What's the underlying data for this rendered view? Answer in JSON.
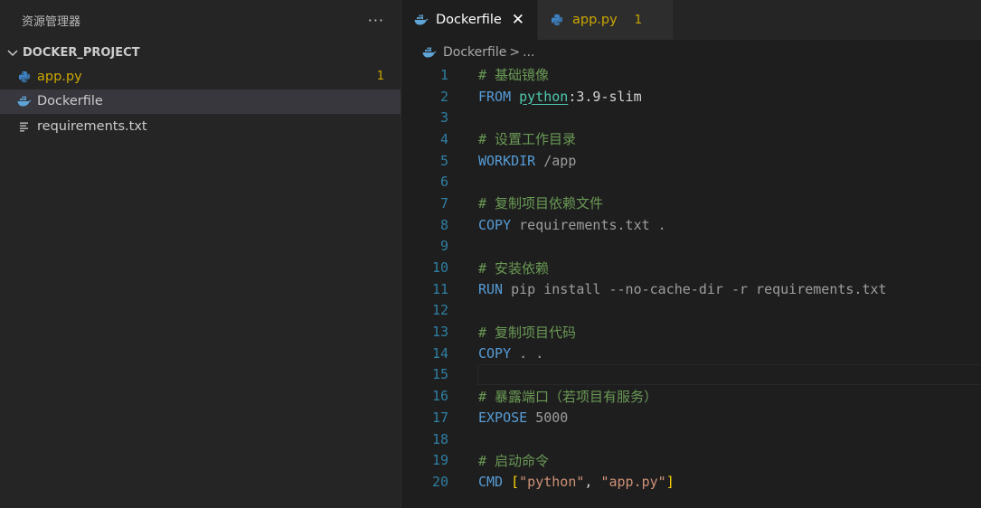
{
  "explorer": {
    "title": "资源管理器",
    "more": "···",
    "section": "DOCKER_PROJECT",
    "files": [
      {
        "name": "app.py",
        "icon": "python-icon",
        "badge": "1"
      },
      {
        "name": "Dockerfile",
        "icon": "docker-icon",
        "badge": ""
      },
      {
        "name": "requirements.txt",
        "icon": "text-file-icon",
        "badge": ""
      }
    ]
  },
  "tabs": [
    {
      "name": "Dockerfile",
      "close": "✕"
    },
    {
      "name": "app.py",
      "badge": "1"
    }
  ],
  "breadcrumb": {
    "file": "Dockerfile",
    "sep": ">",
    "more": "..."
  },
  "code": {
    "lines": [
      {
        "n": "1",
        "comment": "# 基础镜像"
      },
      {
        "n": "2",
        "kw": "FROM",
        "image": "python",
        "rest": ":3.9-slim"
      },
      {
        "n": "3"
      },
      {
        "n": "4",
        "comment": "# 设置工作目录"
      },
      {
        "n": "5",
        "kw": "WORKDIR",
        "arg": "/app"
      },
      {
        "n": "6"
      },
      {
        "n": "7",
        "comment": "# 复制项目依赖文件"
      },
      {
        "n": "8",
        "kw": "COPY",
        "arg": "requirements.txt ."
      },
      {
        "n": "9"
      },
      {
        "n": "10",
        "comment": "# 安装依赖"
      },
      {
        "n": "11",
        "kw": "RUN",
        "arg": "pip install --no-cache-dir -r requirements.txt"
      },
      {
        "n": "12"
      },
      {
        "n": "13",
        "comment": "# 复制项目代码"
      },
      {
        "n": "14",
        "kw": "COPY",
        "arg": ". ."
      },
      {
        "n": "15"
      },
      {
        "n": "16",
        "comment": "# 暴露端口（若项目有服务）"
      },
      {
        "n": "17",
        "kw": "EXPOSE",
        "arg": "5000"
      },
      {
        "n": "18"
      },
      {
        "n": "19",
        "comment": "# 启动命令"
      },
      {
        "n": "20",
        "kw": "CMD",
        "open": "[",
        "s1": "\"python\"",
        "comma": ", ",
        "s2": "\"app.py\"",
        "close": "]"
      }
    ]
  },
  "colors": {
    "keyword": "#569cd6",
    "comment": "#6a9955",
    "warning": "#cca700",
    "line_number": "#2f7fa3"
  }
}
